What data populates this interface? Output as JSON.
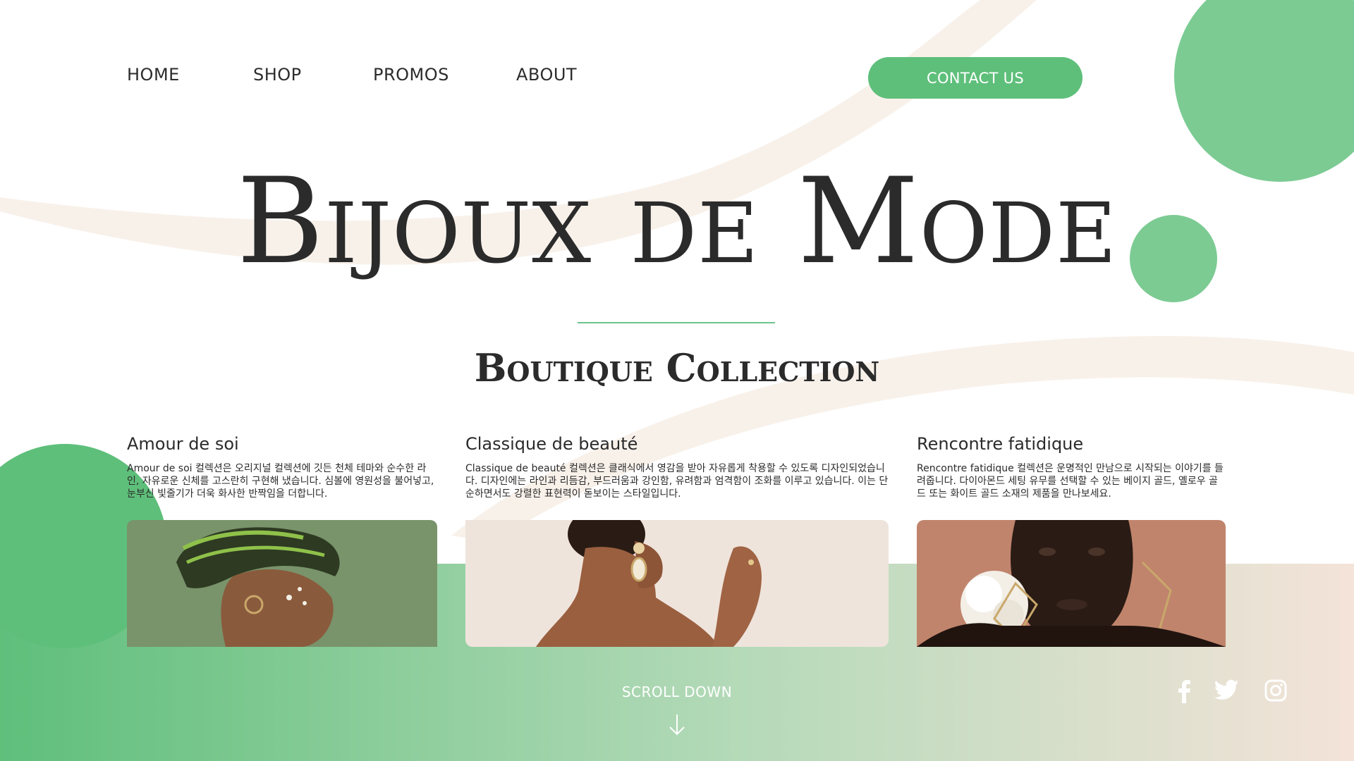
{
  "nav": {
    "home": "HOME",
    "shop": "SHOP",
    "promos": "PROMOS",
    "about": "ABOUT",
    "contact": "CONTACT US"
  },
  "hero": {
    "title": "Bijoux de Mode",
    "subtitle": "Boutique Collection"
  },
  "cards": [
    {
      "title": "Amour de soi",
      "description": "Amour de soi 컬렉션은 오리지널 컬렉션에 깃든 천체 테마와 순수한 라인, 자유로운 신체를 고스란히 구현해 냈습니다. 심볼에 영원성을 불어넣고, 눈부신 빛줄기가 더욱 화사한 반짝임을 더합니다."
    },
    {
      "title": "Classique de beauté",
      "description": "Classique de beauté 컬렉션은 클래식에서 영감을 받아 자유롭게 착용할 수 있도록 디자인되었습니다. 디자인에는 라인과 리듬감, 부드러움과 강인함, 유려함과 엄격함이 조화를 이루고 있습니다. 이는 단순하면서도 강렬한 표현력이 돋보이는 스타일입니다."
    },
    {
      "title": "Rencontre fatidique",
      "description": "Rencontre fatidique 컬렉션은 운명적인 만남으로 시작되는 이야기를 들려줍니다. 다이아몬드 세팅 유무를 선택할 수 있는 베이지 골드, 옐로우 골드 또는 화이트 골드 소재의 제품을 만나보세요."
    }
  ],
  "footer": {
    "scroll": "SCROLL DOWN",
    "scroll_icon": "arrow-down-icon",
    "social": [
      "facebook-icon",
      "twitter-icon",
      "instagram-icon"
    ]
  },
  "colors": {
    "accent_green": "#5ebf7a",
    "light_green": "#7ccb93",
    "cream": "#f8f1ea",
    "peach": "#f3e3d9",
    "text": "#2b2b2b"
  }
}
